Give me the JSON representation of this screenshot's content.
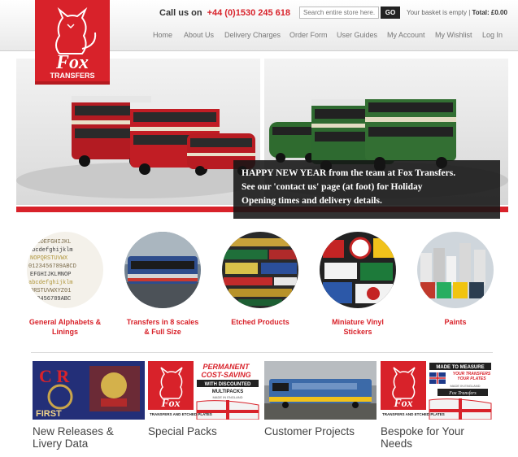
{
  "header": {
    "logo_text": "Fox",
    "logo_sub": "TRANSFERS",
    "call_label": "Call us on",
    "phone": "+44 (0)1530 245 618",
    "search_placeholder": "Search entire store here...",
    "search_button": "GO",
    "basket_text": "Your basket is empty |",
    "total_label": "Total: £0.00"
  },
  "nav": [
    "Home",
    "About Us",
    "Delivery Charges",
    "Order Form",
    "User Guides",
    "My Account",
    "My Wishlist",
    "Log In"
  ],
  "hero": {
    "caption_line1": "HAPPY NEW YEAR from the team at Fox Transfers.",
    "caption_line2": "See our 'contact us' page (at foot) for Holiday",
    "caption_line3": "Opening times and delivery details."
  },
  "categories": [
    {
      "line1": "General Alphabets &",
      "line2": "Linings"
    },
    {
      "line1": "Transfers in 8 scales",
      "line2": "& Full Size"
    },
    {
      "line1": "Etched Products",
      "line2": ""
    },
    {
      "line1": "Miniature Vinyl",
      "line2": "Stickers"
    },
    {
      "line1": "Paints",
      "line2": ""
    }
  ],
  "promos": [
    {
      "line1": "New Releases &",
      "line2": "Livery Data",
      "img_text": "FIRST"
    },
    {
      "line1": "Special Packs",
      "line2": "",
      "img_line1": "PERMANENT",
      "img_line2": "COST-SAVING",
      "img_line3": "WITH DISCOUNTED",
      "img_line4": "MULTIPACKS",
      "img_line5": "MADE IN ENGLAND",
      "img_sub": "TRANSFERS AND ETCHED PLATES"
    },
    {
      "line1": "Customer Projects",
      "line2": ""
    },
    {
      "line1": "Bespoke for Your",
      "line2": "Needs",
      "img_line1": "MADE TO MEASURE",
      "img_line2": "YOUR TRANSFERS",
      "img_line3": "YOUR PLATES",
      "img_line4": "MADE IN ENGLAND",
      "img_line5": "Fox Transfers",
      "img_sub": "TRANSFERS AND ETCHED PLATES"
    }
  ],
  "colors": {
    "brand_red": "#d8222a",
    "dark": "#222222"
  }
}
